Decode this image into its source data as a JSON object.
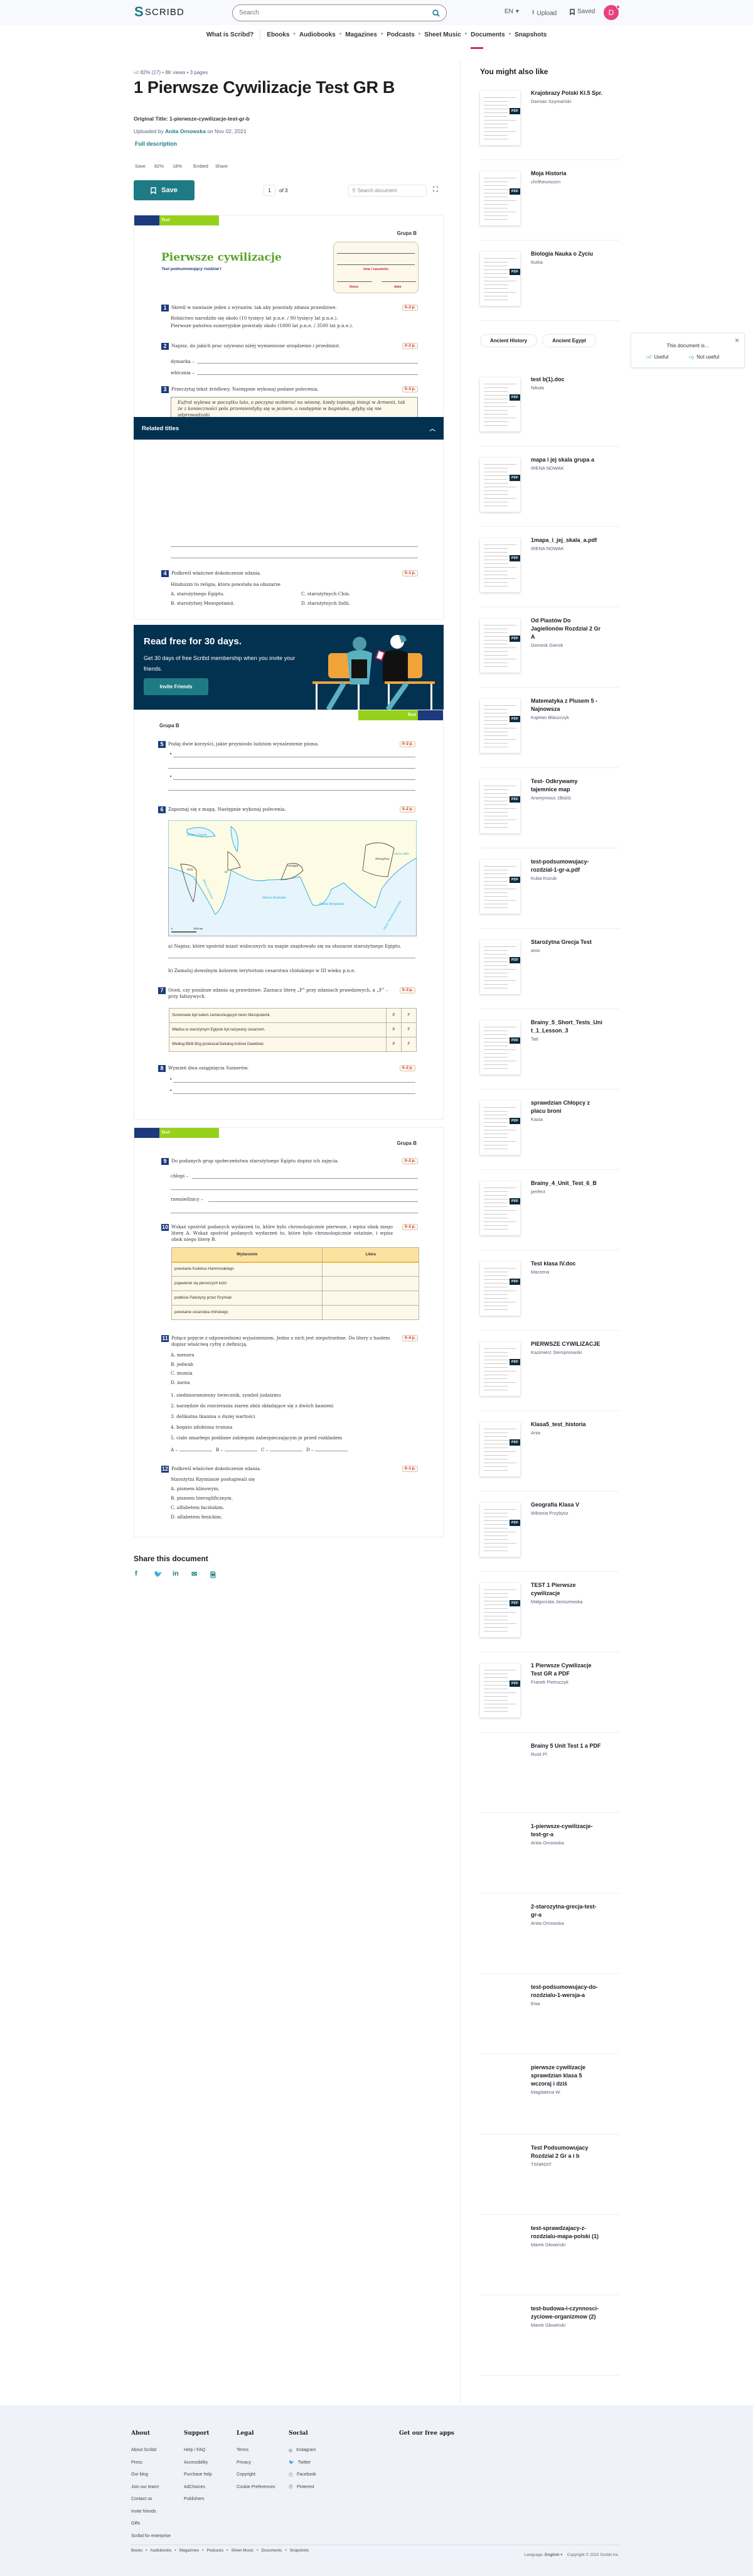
{
  "header": {
    "logo": "SCRIBD",
    "search_placeholder": "Search",
    "lang": "EN",
    "upload": "Upload",
    "saved": "Saved",
    "avatar_initial": "D"
  },
  "nav": [
    "What is Scribd?",
    "Ebooks",
    "Audiobooks",
    "Magazines",
    "Podcasts",
    "Sheet Music",
    "Documents",
    "Snapshots"
  ],
  "nav_active": "Documents",
  "doc": {
    "rating": "82% (17)",
    "views": "8K views",
    "pages": "3 pages",
    "title": "1 Pierwsze Cywilizacje Test GR B",
    "original_title_label": "Original Title:",
    "original_title": "1-pierwsze-cywilizacje-test-gr-b",
    "uploaded_by": "Uploaded by",
    "uploader": "Anita Ornowska",
    "uploaded_on": "on Nov 02, 2021",
    "full_description": "Full description",
    "actions": [
      {
        "icon": "bookmark-icon",
        "label": "Save"
      },
      {
        "icon": "thumbs-up-icon",
        "label": "82%"
      },
      {
        "icon": "thumbs-down-icon",
        "label": "18%"
      },
      {
        "icon": "embed-icon",
        "label": "Embed"
      },
      {
        "icon": "share-icon",
        "label": "Share"
      }
    ],
    "save_button": "Save",
    "page_current": "1",
    "page_of": "of 3",
    "search_doc_placeholder": "Search document"
  },
  "page1": {
    "tab": "Test",
    "grupa": "Grupa B",
    "title": "Pierwsze cywilizacje",
    "subtitle": "Test podsumowujący rozdział I",
    "name_label": "imię i nazwisko",
    "class_label": "klasa",
    "date_label": "data",
    "q1": {
      "n": "1",
      "text": "Skreśl w nawiasie jeden z wyrazów, tak aby powstały zdania prawdziwe.",
      "pts": "0–2 p.",
      "l1": "Rolnictwo narodziło się około (10 tysięcy lat p.n.e. / 90 tysięcy lat p.n.e.).",
      "l2": "Pierwsze państwa sumeryjskie powstały około (1800 lat p.n.e. / 3500 lat p.n.e.)."
    },
    "q2": {
      "n": "2",
      "text": "Napisz, do jakich prac używano niżej wymienione urządzenie i przedmiot.",
      "pts": "0–2 p.",
      "a": "dymarka –",
      "b": "włócznia –"
    },
    "q3": {
      "n": "3",
      "text": "Przeczytaj tekst źródłowy. Następnie wykonaj podane polecenia.",
      "pts": "0–3 p.",
      "quote1": "Eufrat wylewa w początku lata, a poczyna wzbierać na wiosnę, kiedy topnieją śniegi w Armenii, tak",
      "quote2": "że z konieczności pola przemieniłyby się w jezioro, a następnie w bagnisko, gdyby się nie odprowadzało"
    },
    "q4": {
      "n": "4",
      "text": "Podkreśl właściwe dokończenie zdania.",
      "pts": "0–1 p.",
      "stem": "Hinduizm to religia, która powstała na obszarze",
      "a": "A. starożytnego Egiptu.",
      "b": "B. starożytnej Mezopotamii.",
      "c": "C. starożytnych Chin.",
      "d": "D. starożytnych Indii."
    }
  },
  "related_titles": "Related titles",
  "banner": {
    "title": "Read free for 30 days.",
    "text": "Get 30 days of free Scribd membership when you invite your friends.",
    "button": "Invite Friends"
  },
  "page2": {
    "tab": "Test",
    "grupa": "Grupa B",
    "q5": {
      "n": "5",
      "text": "Podaj dwie korzyści, jakie przyniosło ludziom wynalezienie pisma.",
      "pts": "0–2 p."
    },
    "q6": {
      "n": "6",
      "text": "Zapoznaj się z mapą. Następnie wykonaj polecenia.",
      "pts": "0–2 p.",
      "a": "a) Napisz, które spośród miast widocznych na mapie znajdowało się na obszarze starożytnego Egiptu.",
      "b": "b) Zamaluj dowolnym kolorem terytorium cesarstwa chińskiego w III wieku p.n.e.",
      "map_labels": {
        "black_sea": "Morze Czarne",
        "giza": "Giza",
        "ur": "Ur",
        "harappa": "Harappa",
        "zhengzhou": "Zhengzhou",
        "arabian": "Morze Arabskie",
        "bengal": "Zatoka Bengalska",
        "yellow": "Morze Żółte",
        "south_china": "Morze Południowochińskie",
        "red": "Morze Czerwone",
        "scale0": "0",
        "scale": "1000 km"
      }
    },
    "q7": {
      "n": "7",
      "text": "Oceń, czy poniższe zdania są prawdziwe. Zaznacz literę „P” przy zdaniach prawdziwych, a „F” – przy fałszywych.",
      "pts": "0–3 p.",
      "rows": [
        "Sumerowie byli ludem zamieszkującym teren Mezopotamii.",
        "Władca w starożytnym Egipcie był nazywany cesarzem.",
        "Według Biblii Bóg przekazał Dekalog królowi Dawidowi."
      ],
      "p": "P",
      "f": "F"
    },
    "q8": {
      "n": "8",
      "text": "Wymień dwa osiągnięcia Sumerów.",
      "pts": "0–2 p."
    }
  },
  "page3": {
    "tab": "Test",
    "grupa": "Grupa B",
    "q9": {
      "n": "9",
      "text": "Do podanych grup społeczeństwa starożytnego Egiptu dopisz ich zajęcia.",
      "pts": "0–2 p.",
      "a": "chłopi –",
      "b": "rzemieślnicy –"
    },
    "q10": {
      "n": "10",
      "text": "Wskaż spośród podanych wydarzeń to, które było chronologicznie pierwsze, i wpisz obok niego literę A. Wskaż spośród podanych wydarzeń to, które było chronologicznie ostatnie, i wpisz obok niego literę B.",
      "pts": "0–2 p.",
      "col1": "Wydarzenie",
      "col2": "Litera",
      "rows": [
        "powstanie Kodeksu Hammurabiego",
        "pojawienie się pierwszych ludzi",
        "podbicie Palestyny przez Rzymian",
        "powstanie cesarstwa chińskiego"
      ]
    },
    "q11": {
      "n": "11",
      "text": "Połącz pojęcie z odpowiednimi wyjaśnieniem. Jedno z nich jest niepotrzebne. Do litery z hasłem dopisz właściwą cyfrę z definicją.",
      "pts": "0–4 p.",
      "terms": [
        "A. menora",
        "B. jedwab",
        "C. mumia",
        "D. żarna"
      ],
      "defs": [
        "1. siedmioramienny świecznik, symbol judaizmu",
        "2. narzędzie do rozcierania ziaren zbóż składające się z dwóch kamieni",
        "3. delikatna tkanina o dużej wartości",
        "4. bogato zdobiona trumna",
        "5. ciało zmarłego poddane zabiegom zabezpieczającym je przed rozkładem"
      ],
      "answers": [
        "A –",
        "B –",
        "C –",
        "D –"
      ]
    },
    "q12": {
      "n": "12",
      "text": "Podkreśl właściwe dokończenie zdania.",
      "pts": "0–1 p.",
      "stem": "Starożytni Rzymianie posługiwali się",
      "opts": [
        "A. pismem klinowym.",
        "B. pismem hieroglificznym.",
        "C. alfabetem łacińskim.",
        "D. alfabetem fenickim."
      ]
    }
  },
  "share": {
    "title": "Share this document",
    "icons": [
      "facebook-icon",
      "twitter-icon",
      "linkedin-icon",
      "email-icon",
      "copy-link-icon"
    ]
  },
  "sidebar": {
    "title": "You might also like",
    "tags": [
      "Ancient History",
      "Ancient Egypt"
    ],
    "items": [
      {
        "title": "Krajobrazy Polski Kl.5 Spr.",
        "author": "Damian Szymański",
        "thumb": true
      },
      {
        "title": "Moja Historia",
        "author": "chrltheunicorn",
        "thumb": true
      },
      {
        "title": "Biologia Nauka o Zyciu",
        "author": "liszka",
        "thumb": true
      },
      {
        "title": "test b(1).doc",
        "author": "Nikola",
        "thumb": true
      },
      {
        "title": "mapa i jej skala grupa a",
        "author": "IRENA NOWAK",
        "thumb": true
      },
      {
        "title": "1mapa_i_jej_skala_a.pdf",
        "author": "IRENA NOWAK",
        "thumb": true
      },
      {
        "title": "Od Piastów Do Jagiellonów Rozdzial 2 Gr A",
        "author": "Dominik Gierok",
        "thumb": true
      },
      {
        "title": "Matematyka z Plusem 5 - Najnowsza",
        "author": "Kajetan Błaszczyk",
        "thumb": true
      },
      {
        "title": "Test- Odkrywamy tajemnice map",
        "author": "Anonymous 1Bdzlz",
        "thumb": true
      },
      {
        "title": "test-podsumowujacy-rozdzial-1-gr-a.pdf",
        "author": "Kuba Kozub",
        "thumb": true
      },
      {
        "title": "Starożytna Grecja Test",
        "author": "ania",
        "thumb": true
      },
      {
        "title": "Brainy_5_Short_Tests_Unit_1_Lesson_3",
        "author": "Tati",
        "thumb": true
      },
      {
        "title": "sprawdzian Chłopcy z placu broni",
        "author": "Kasia",
        "thumb": true
      },
      {
        "title": "Brainy_4_Unit_Test_6_B",
        "author": "perfect",
        "thumb": true
      },
      {
        "title": "Test klasa IV.doc",
        "author": "Marzena",
        "thumb": true
      },
      {
        "title": "PIERWSZE CYWILIZACJE",
        "author": "Kazimierz Stempniowski",
        "thumb": true
      },
      {
        "title": "Klasa5_test_historia",
        "author": "Ania",
        "thumb": true
      },
      {
        "title": "Geografia Klasa V",
        "author": "Wiktoria Przybysz",
        "thumb": true
      },
      {
        "title": "TEST 1 Pierwsze cywilizacje",
        "author": "Małgorzata Jaroszewska",
        "thumb": true
      },
      {
        "title": "1 Pierwsze Cywilizacje Test GR a PDF",
        "author": "Franek Pietruczyk",
        "thumb": true
      },
      {
        "title": "Brainy 5 Unit Test 1 a PDF",
        "author": "Rusli Pl",
        "thumb": false
      },
      {
        "title": "1-pierwsze-cywilizacje-test-gr-a",
        "author": "Anita Ornowska",
        "thumb": false
      },
      {
        "title": "2-starozytna-grecja-test-gr-a",
        "author": "Anita Ornowska",
        "thumb": false
      },
      {
        "title": "test-podsumowujacy-do-rozdzialu-1-wersja-a",
        "author": "Ewa",
        "thumb": false
      },
      {
        "title": "pierwsze cywilizacje sprawdzian klasa 5 wczoraj i dziś",
        "author": "Magdalena W.",
        "thumb": false
      },
      {
        "title": "Test Podsumowujacy Rozdzial 2 Gr a i b",
        "author": "TSNROIT",
        "thumb": false
      },
      {
        "title": "test-sprawdzajacy-z-rozdzialu-mapa-polski (1)",
        "author": "Marek Głowiński",
        "thumb": false
      },
      {
        "title": "test-budowa-i-czynnosci-zyciowe-organizmow (2)",
        "author": "Marek Głowiński",
        "thumb": false
      }
    ],
    "pdf_badge": "PDF"
  },
  "feedback": {
    "prompt": "This document is...",
    "useful": "Useful",
    "not_useful": "Not useful"
  },
  "footer": {
    "columns": [
      {
        "title": "About",
        "links": [
          "About Scribd",
          "Press",
          "Our blog",
          "Join our team!",
          "Contact us",
          "Invite friends",
          "Gifts",
          "Scribd for enterprise"
        ]
      },
      {
        "title": "Support",
        "links": [
          "Help / FAQ",
          "Accessibility",
          "Purchase help",
          "AdChoices",
          "Publishers"
        ]
      },
      {
        "title": "Legal",
        "links": [
          "Terms",
          "Privacy",
          "Copyright",
          "Cookie Preferences"
        ]
      },
      {
        "title": "Social",
        "links": [
          "Instagram",
          "Twitter",
          "Facebook",
          "Pinterest"
        ]
      }
    ],
    "apps_title": "Get our free apps",
    "bottom_links": [
      "Books",
      "Audiobooks",
      "Magazines",
      "Podcasts",
      "Sheet Music",
      "Documents",
      "Snapshots"
    ],
    "language_label": "Language:",
    "language": "English",
    "copyright": "Copyright © 2022 Scribd Inc."
  },
  "colors": {
    "brand": "#1e7b85",
    "navy": "#033150",
    "accent": "#cc2e6a",
    "avatar": "#e8417b"
  }
}
